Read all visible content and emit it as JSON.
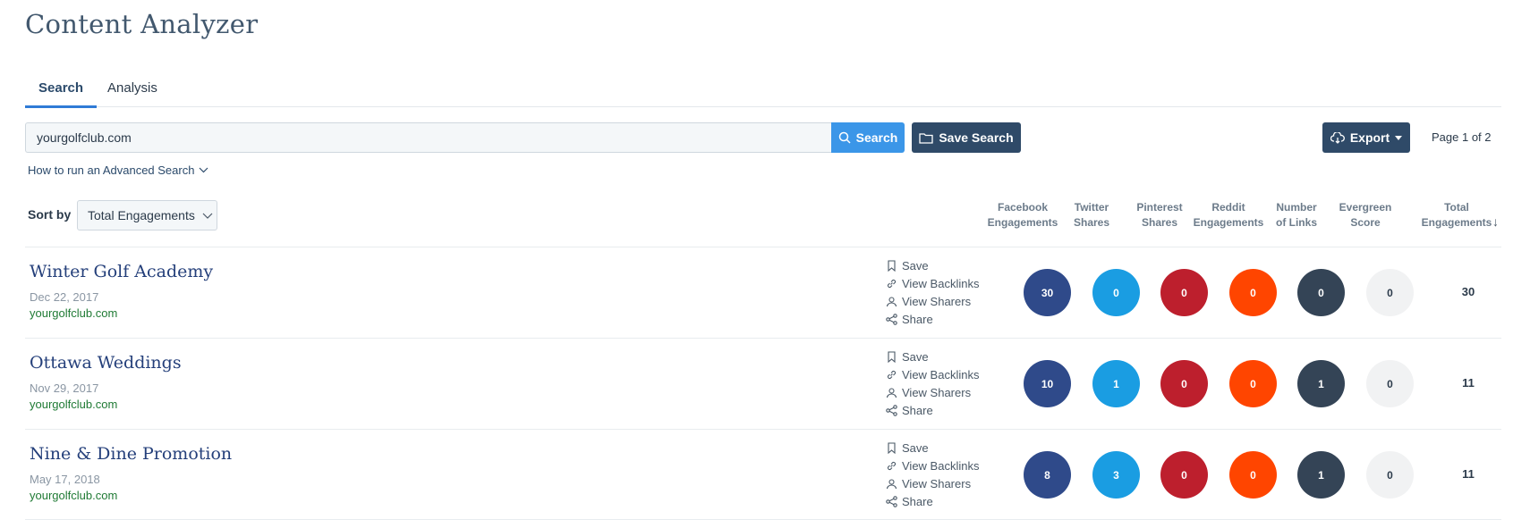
{
  "page": {
    "title": "Content Analyzer"
  },
  "tabs": [
    {
      "label": "Search",
      "active": true
    },
    {
      "label": "Analysis",
      "active": false
    }
  ],
  "search": {
    "value": "yourgolfclub.com",
    "search_button": "Search",
    "save_search_button": "Save Search",
    "export_button": "Export",
    "page_indicator": "Page 1 of 2",
    "advanced_link": "How to run an Advanced Search"
  },
  "sort": {
    "label": "Sort by",
    "selected": "Total Engagements"
  },
  "columns": [
    {
      "line1": "Facebook",
      "line2": "Engagements"
    },
    {
      "line1": "Twitter",
      "line2": "Shares"
    },
    {
      "line1": "Pinterest",
      "line2": "Shares"
    },
    {
      "line1": "Reddit",
      "line2": "Engagements"
    },
    {
      "line1": "Number",
      "line2": "of Links"
    },
    {
      "line1": "Evergreen",
      "line2": "Score"
    },
    {
      "line1": "Total",
      "line2": "Engagements"
    }
  ],
  "actions": {
    "save": "Save",
    "backlinks": "View Backlinks",
    "sharers": "View Sharers",
    "share": "Share"
  },
  "colors": {
    "facebook": "#2f4a8a",
    "twitter": "#1a9de2",
    "pinterest": "#bd1f2d",
    "reddit": "#ff4500",
    "links": "#344456",
    "evergreen": "#f1f2f3",
    "accent": "#3b96e8"
  },
  "rows": [
    {
      "title": "Winter Golf Academy",
      "date": "Dec 22, 2017",
      "domain": "yourgolfclub.com",
      "facebook": "30",
      "twitter": "0",
      "pinterest": "0",
      "reddit": "0",
      "links": "0",
      "evergreen": "0",
      "total": "30"
    },
    {
      "title": "Ottawa Weddings",
      "date": "Nov 29, 2017",
      "domain": "yourgolfclub.com",
      "facebook": "10",
      "twitter": "1",
      "pinterest": "0",
      "reddit": "0",
      "links": "1",
      "evergreen": "0",
      "total": "11"
    },
    {
      "title": "Nine & Dine Promotion",
      "date": "May 17, 2018",
      "domain": "yourgolfclub.com",
      "facebook": "8",
      "twitter": "3",
      "pinterest": "0",
      "reddit": "0",
      "links": "1",
      "evergreen": "0",
      "total": "11"
    }
  ]
}
